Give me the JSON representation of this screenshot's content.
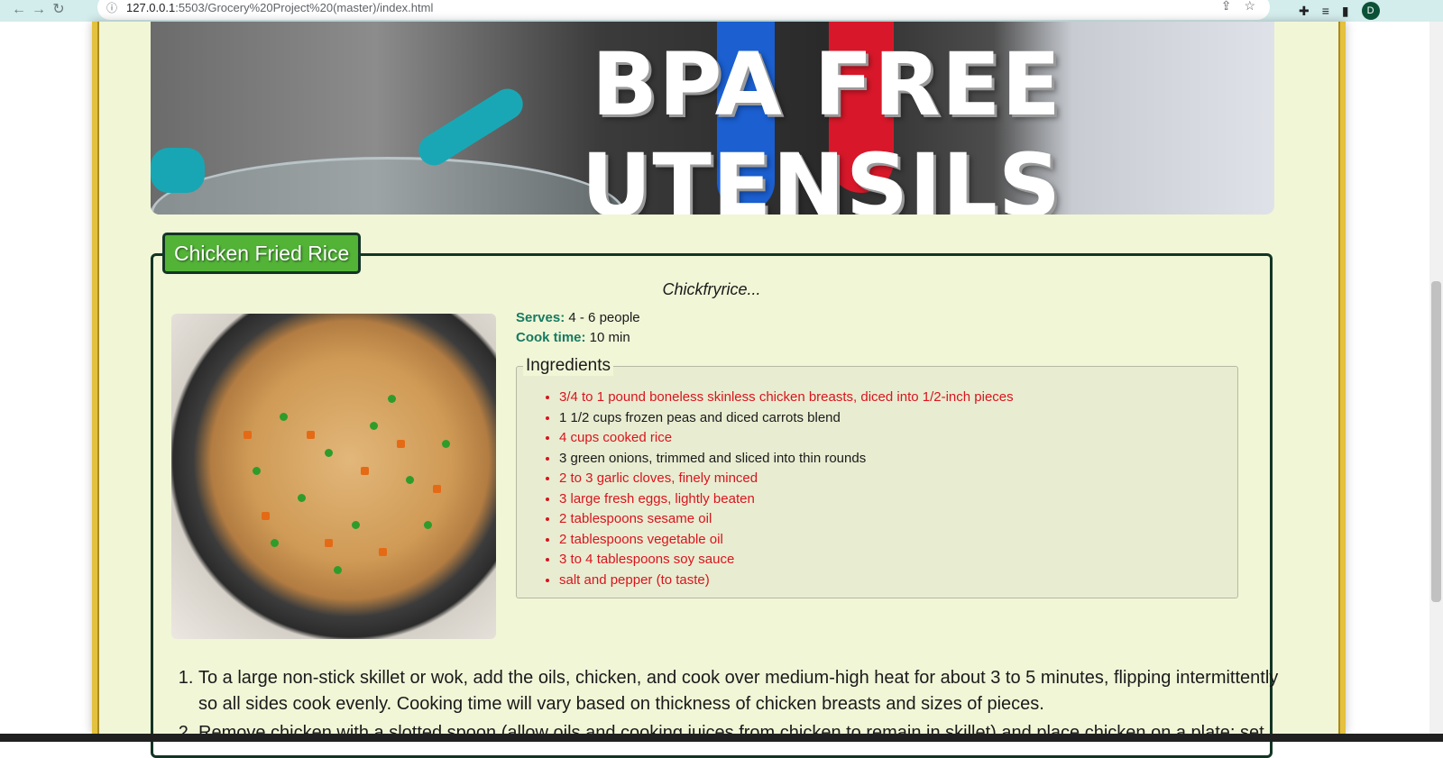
{
  "browser": {
    "url_host": "127.0.0.1",
    "url_path": ":5503/Grocery%20Project%20(master)/index.html",
    "profile_initial": "D"
  },
  "banner": {
    "title": "BPA FREE UTENSILS"
  },
  "recipe": {
    "title": "Chicken Fried Rice",
    "tagline": "Chickfryrice...",
    "serves_label": "Serves:",
    "serves_value": " 4 - 6 people",
    "cook_time_label": "Cook time:",
    "cook_time_value": " 10 min",
    "ingredients_heading": "Ingredients",
    "ingredients": [
      "3/4 to 1 pound boneless skinless chicken breasts, diced into 1/2-inch pieces",
      "1 1/2 cups frozen peas and diced carrots blend",
      "4 cups cooked rice",
      "3 green onions, trimmed and sliced into thin rounds",
      "2 to 3 garlic cloves, finely minced",
      "3 large fresh eggs, lightly beaten",
      "2 tablespoons sesame oil",
      "2 tablespoons vegetable oil",
      "3 to 4 tablespoons soy sauce",
      "salt and pepper (to taste)"
    ],
    "steps": [
      "To a large non-stick skillet or wok, add the oils, chicken, and cook over medium-high heat for about 3 to 5 minutes, flipping intermittently so all sides cook evenly. Cooking time will vary based on thickness of chicken breasts and sizes of pieces.",
      "Remove chicken with a slotted spoon (allow oils and cooking juices from chicken to remain in skillet) and place chicken on a plate; set"
    ]
  },
  "colors": {
    "page_background": "#f1f6d7",
    "frame_gold": "#e4c13e",
    "legend_green": "#52b337",
    "label_teal": "#177a60",
    "ingredient_red": "#d9141f"
  }
}
